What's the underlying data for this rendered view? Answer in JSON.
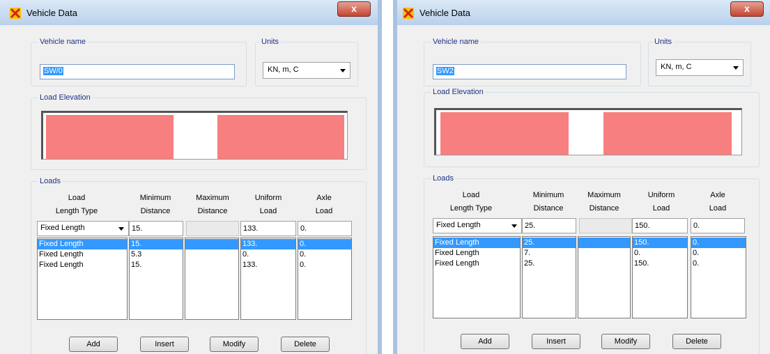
{
  "left_window": {
    "title": "Vehicle Data",
    "close_label": "x",
    "vehicle_name_label": "Vehicle name",
    "vehicle_name": "SW/0",
    "units_label": "Units",
    "units_value": "KN, m, C",
    "load_elevation_label": "Load Elevation",
    "loads_label": "Loads",
    "headers": {
      "length_type": [
        "Load",
        "Length Type"
      ],
      "min_distance": [
        "Minimum",
        "Distance"
      ],
      "max_distance": [
        "Maximum",
        "Distance"
      ],
      "uniform_load": [
        "Uniform",
        "Load"
      ],
      "axle_load": [
        "Axle",
        "Load"
      ]
    },
    "edit_row": {
      "length_type": "Fixed Length",
      "min_distance": "15.",
      "max_distance": "",
      "uniform_load": "133.",
      "axle_load": "0."
    },
    "rows": [
      {
        "length_type": "Fixed Length",
        "min_distance": "15.",
        "max_distance": "",
        "uniform_load": "133.",
        "axle_load": "0."
      },
      {
        "length_type": "Fixed Length",
        "min_distance": "5.3",
        "max_distance": "",
        "uniform_load": "0.",
        "axle_load": "0."
      },
      {
        "length_type": "Fixed Length",
        "min_distance": "15.",
        "max_distance": "",
        "uniform_load": "133.",
        "axle_load": "0."
      }
    ],
    "buttons": {
      "add": "Add",
      "insert": "Insert",
      "modify": "Modify",
      "delete": "Delete"
    }
  },
  "right_window": {
    "title": "Vehicle Data",
    "close_label": "x",
    "vehicle_name_label": "Vehicle name",
    "vehicle_name": "SW2",
    "units_label": "Units",
    "units_value": "KN, m, C",
    "load_elevation_label": "Load Elevation",
    "loads_label": "Loads",
    "headers": {
      "length_type": [
        "Load",
        "Length Type"
      ],
      "min_distance": [
        "Minimum",
        "Distance"
      ],
      "max_distance": [
        "Maximum",
        "Distance"
      ],
      "uniform_load": [
        "Uniform",
        "Load"
      ],
      "axle_load": [
        "Axle",
        "Load"
      ]
    },
    "edit_row": {
      "length_type": "Fixed Length",
      "min_distance": "25.",
      "max_distance": "",
      "uniform_load": "150.",
      "axle_load": "0."
    },
    "rows": [
      {
        "length_type": "Fixed Length",
        "min_distance": "25.",
        "max_distance": "",
        "uniform_load": "150.",
        "axle_load": "0."
      },
      {
        "length_type": "Fixed Length",
        "min_distance": "7.",
        "max_distance": "",
        "uniform_load": "0.",
        "axle_load": "0."
      },
      {
        "length_type": "Fixed Length",
        "min_distance": "25.",
        "max_distance": "",
        "uniform_load": "150.",
        "axle_load": "0."
      }
    ],
    "buttons": {
      "add": "Add",
      "insert": "Insert",
      "modify": "Modify",
      "delete": "Delete"
    }
  },
  "colors": {
    "load_bar": "#f77f7f",
    "selection": "#3399ff",
    "group_label": "#1e3287"
  },
  "icons": {
    "title": "sap-x-icon",
    "dropdown": "chevron-down-icon"
  }
}
